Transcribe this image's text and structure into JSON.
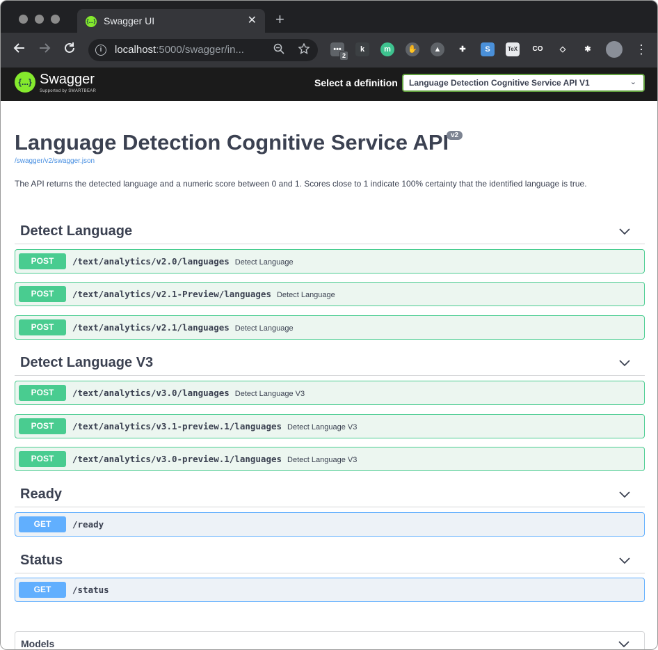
{
  "browser": {
    "tab_title": "Swagger UI",
    "tab_favicon": "{...}",
    "tab_close": "✕",
    "new_tab": "+",
    "url_host": "localhost",
    "url_rest": ":5000/swagger/in...",
    "extension_badge": "2",
    "extensions": [
      "puzzle-icon",
      "menu-icon"
    ]
  },
  "swagger": {
    "logo_badge": "{...}",
    "logo_name": "Swagger",
    "logo_sub": "Supported by SMARTBEAR",
    "select_label": "Select a definition",
    "select_value": "Language Detection Cognitive Service API V1",
    "accent_color": "#85ea2d"
  },
  "info": {
    "title": "Language Detection Cognitive Service API",
    "version": "v2",
    "spec_url": "/swagger/v2/swagger.json",
    "description": "The API returns the detected language and a numeric score between 0 and 1. Scores close to 1 indicate 100% certainty that the identified language is true."
  },
  "tags": [
    {
      "name": "Detect Language",
      "operations": [
        {
          "method": "POST",
          "path": "/text/analytics/v2.0/languages",
          "summary": "Detect Language"
        },
        {
          "method": "POST",
          "path": "/text/analytics/v2.1-Preview/languages",
          "summary": "Detect Language"
        },
        {
          "method": "POST",
          "path": "/text/analytics/v2.1/languages",
          "summary": "Detect Language"
        }
      ]
    },
    {
      "name": "Detect Language V3",
      "operations": [
        {
          "method": "POST",
          "path": "/text/analytics/v3.0/languages",
          "summary": "Detect Language V3"
        },
        {
          "method": "POST",
          "path": "/text/analytics/v3.1-preview.1/languages",
          "summary": "Detect Language V3"
        },
        {
          "method": "POST",
          "path": "/text/analytics/v3.0-preview.1/languages",
          "summary": "Detect Language V3"
        }
      ]
    },
    {
      "name": "Ready",
      "operations": [
        {
          "method": "GET",
          "path": "/ready",
          "summary": ""
        }
      ]
    },
    {
      "name": "Status",
      "operations": [
        {
          "method": "GET",
          "path": "/status",
          "summary": ""
        }
      ]
    }
  ],
  "models": {
    "label": "Models"
  },
  "colors": {
    "post": "#49cc90",
    "get": "#61affe",
    "topbar": "#1b1b1b"
  }
}
